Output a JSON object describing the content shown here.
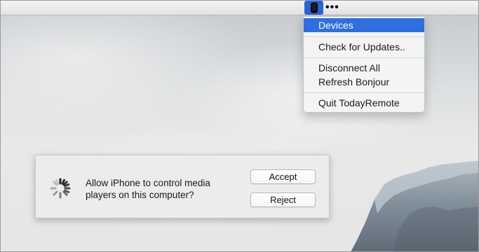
{
  "menubar": {
    "status_icon": "phone-icon",
    "more_icon": "ellipsis-icon",
    "more_label": "•••"
  },
  "menu": {
    "items": [
      {
        "label": "Devices",
        "selected": true
      },
      {
        "label": "Check for Updates.."
      },
      {
        "label": "Disconnect All"
      },
      {
        "label": "Refresh Bonjour"
      },
      {
        "label": "Quit TodayRemote"
      }
    ],
    "highlight_color": "#2e6fe0"
  },
  "dialog": {
    "message": "Allow iPhone to control media players on this computer?",
    "accept_label": "Accept",
    "reject_label": "Reject",
    "spinner_icon": "loading-spinner-icon"
  },
  "colors": {
    "status_item_bg": "#2a63d6",
    "dialog_bg": "#ececec"
  }
}
